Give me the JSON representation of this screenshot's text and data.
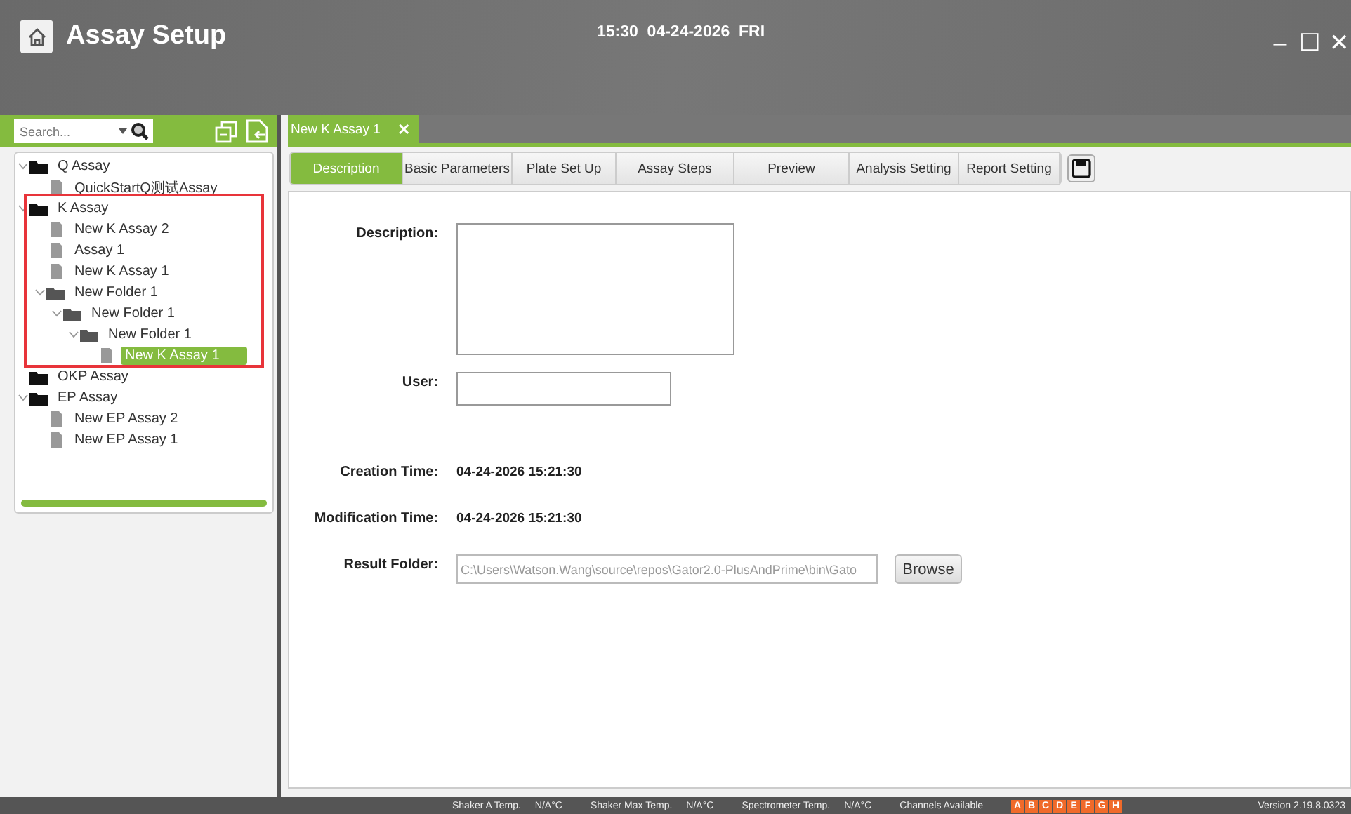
{
  "window": {
    "title": "Assay Setup",
    "clock": "15:30  04-24-2026  FRI",
    "controls": [
      "–",
      "☐",
      "✕"
    ]
  },
  "sidebar": {
    "search": {
      "placeholder": "Search..."
    },
    "tree": [
      {
        "label": "Q Assay",
        "kind": "folder",
        "expanded": true,
        "selected": false,
        "children": [
          {
            "label": "QuickStartQ测试Assay",
            "kind": "file",
            "selected": false
          }
        ]
      },
      {
        "label": "K Assay",
        "kind": "folder",
        "expanded": true,
        "selected": false,
        "children": [
          {
            "label": "New K Assay 2",
            "kind": "file",
            "selected": false
          },
          {
            "label": "Assay 1",
            "kind": "file",
            "selected": false
          },
          {
            "label": "New K Assay 1",
            "kind": "file",
            "selected": false
          },
          {
            "label": "New Folder 1",
            "kind": "folder",
            "expanded": true,
            "selected": false,
            "children": [
              {
                "label": "New Folder 1",
                "kind": "folder",
                "expanded": true,
                "selected": false,
                "children": [
                  {
                    "label": "New Folder 1",
                    "kind": "folder",
                    "expanded": true,
                    "selected": false,
                    "children": [
                      {
                        "label": "New K Assay 1",
                        "kind": "file",
                        "selected": true
                      }
                    ]
                  }
                ]
              }
            ]
          }
        ]
      },
      {
        "label": "OKP Assay",
        "kind": "folder",
        "expanded": false,
        "selected": false
      },
      {
        "label": "EP Assay",
        "kind": "folder",
        "expanded": true,
        "selected": false,
        "children": [
          {
            "label": "New EP Assay 2",
            "kind": "file",
            "selected": false
          },
          {
            "label": "New EP Assay 1",
            "kind": "file",
            "selected": false
          }
        ]
      }
    ]
  },
  "doc_tab": {
    "label": "New K Assay 1",
    "close": "✕"
  },
  "tabs": [
    {
      "label": "Description",
      "selected": true
    },
    {
      "label": "Basic Parameters",
      "selected": false
    },
    {
      "label": "Plate Set Up",
      "selected": false
    },
    {
      "label": "Assay Steps",
      "selected": false
    },
    {
      "label": "Preview",
      "selected": false
    },
    {
      "label": "Analysis Setting",
      "selected": false
    },
    {
      "label": "Report Setting",
      "selected": false
    }
  ],
  "form": [
    {
      "kind": "textarea",
      "label": "Description:"
    },
    {
      "kind": "input",
      "label": "User:"
    },
    {
      "kind": "text",
      "label": "Creation Time:",
      "value": "04-24-2026 15:21:30"
    },
    {
      "kind": "text",
      "label": "Modification Time:",
      "value": "04-24-2026 15:21:30"
    },
    {
      "kind": "folder",
      "label": "Result Folder:",
      "value": "C:\\Users\\Watson.Wang\\source\\repos\\Gator2.0-PlusAndPrime\\bin\\Gato",
      "button": "Browse"
    }
  ],
  "status_bar": {
    "readings": [
      {
        "label": "Shaker A Temp.",
        "value": "N/A°C"
      },
      {
        "label": "Shaker Max Temp.",
        "value": "N/A°C"
      },
      {
        "label": "Spectrometer Temp.",
        "value": "N/A°C"
      }
    ],
    "channels_label": "Channels Available",
    "channels": [
      "A",
      "B",
      "C",
      "D",
      "E",
      "F",
      "G",
      "H"
    ],
    "version": "Version 2.19.8.0323"
  }
}
